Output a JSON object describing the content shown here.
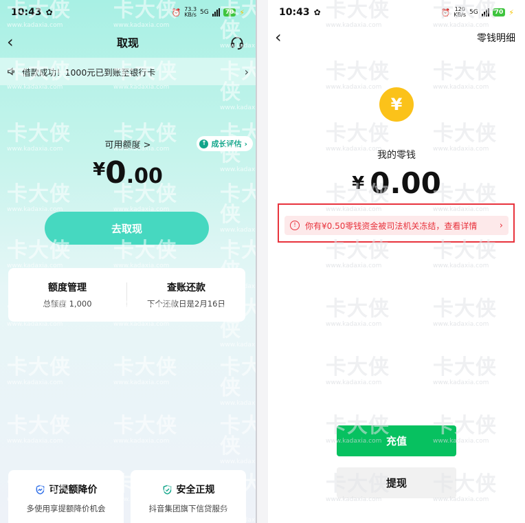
{
  "left": {
    "status": {
      "time": "10:43",
      "speed_top": "73.3",
      "speed_bottom": "KB/s",
      "signal": "5G",
      "battery": "70"
    },
    "nav": {
      "title": "取现"
    },
    "notice": {
      "text": "借款成功！1000元已到账至银行卡"
    },
    "quota_label": "可用额度 >",
    "growth_label": "成长评估",
    "amount": {
      "yen": "¥",
      "int": "0",
      "dec": ".00"
    },
    "withdraw_button": "去取现",
    "card": {
      "manage_title": "额度管理",
      "manage_sub": "总额度 1,000",
      "bill_title": "查账还款",
      "bill_sub": "下个还款日是2月16日"
    },
    "promo": {
      "raise_title": "可提额降价",
      "raise_sub": "多使用享提额降价机会",
      "safe_title": "安全正规",
      "safe_sub": "抖音集团旗下信贷服务"
    }
  },
  "right": {
    "status": {
      "time": "10:43",
      "speed_top": "120",
      "speed_bottom": "KB/s",
      "signal": "5G",
      "battery": "70"
    },
    "nav": {
      "title": "零钱明细"
    },
    "coin": "¥",
    "wallet_label": "我的零钱",
    "amount": {
      "yen": "¥",
      "value": "0.00"
    },
    "alert": "你有¥0.50零钱资金被司法机关冻结，查看详情",
    "recharge_button": "充值",
    "withdraw_button": "提现"
  },
  "watermark": {
    "cn": "卡大侠",
    "en": "www.kadaxia.com"
  },
  "colors": {
    "accent_teal": "#46d8c0",
    "wechat_green": "#07c160",
    "alert_red": "#e8323c",
    "coin_gold": "#fbc21a"
  }
}
